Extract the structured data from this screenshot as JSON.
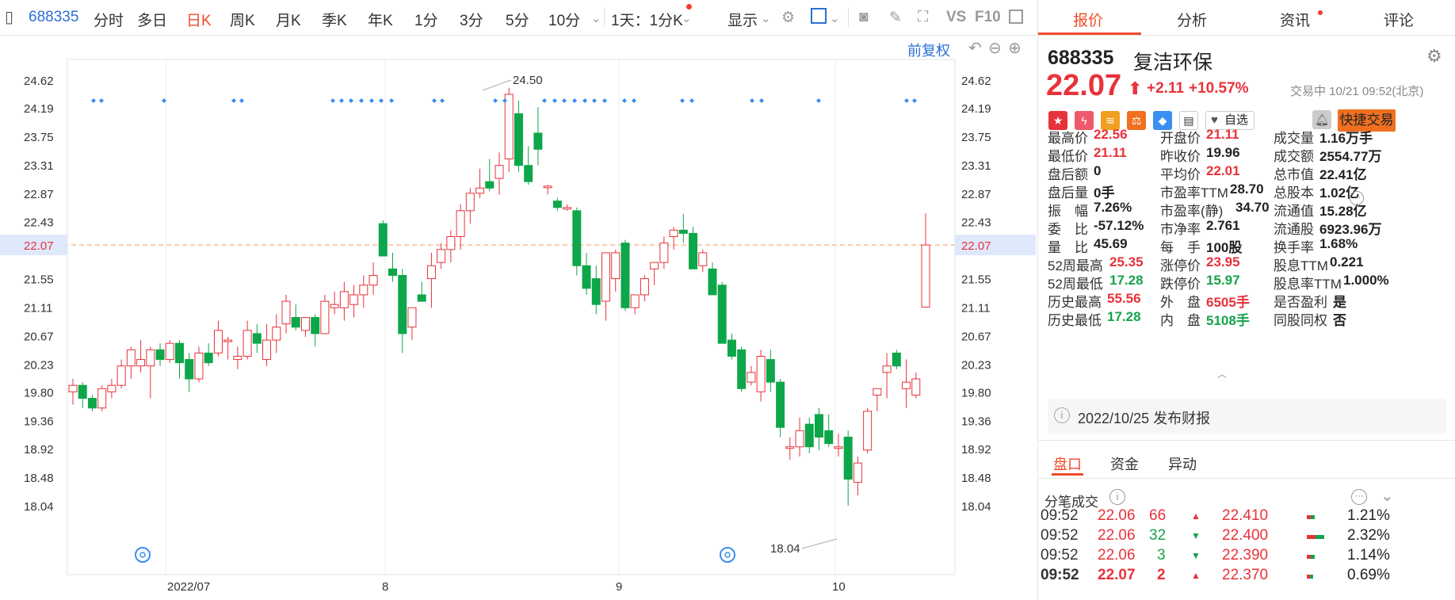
{
  "toolbar": {
    "stock_code": "688335",
    "tabs": [
      "分时",
      "多日",
      "日K",
      "周K",
      "月K",
      "季K",
      "年K",
      "1分",
      "3分",
      "5分",
      "10分"
    ],
    "active_tab": "日K",
    "period_select": "1天：1分K",
    "display_label": "显示",
    "vs_label": "VS",
    "f10_label": "F10",
    "adjust_label": "前复权"
  },
  "chart": {
    "y_ticks": [
      "24.62",
      "24.19",
      "23.75",
      "23.31",
      "22.87",
      "22.43",
      "22.07",
      "21.55",
      "21.11",
      "20.67",
      "20.23",
      "19.80",
      "19.36",
      "18.92",
      "18.48",
      "18.04"
    ],
    "current_price_label": "22.07",
    "x_labels": [
      "2022/07",
      "8",
      "9",
      "10"
    ],
    "high_annotation": "24.50",
    "low_annotation": "18.04"
  },
  "chart_data": {
    "type": "candlestick",
    "ylim": [
      17.8,
      24.8
    ],
    "current_price": 22.07,
    "xlabels": [
      "2022/07",
      "8",
      "9",
      "10"
    ],
    "ohlc": [
      [
        19.8,
        20.0,
        19.6,
        19.9
      ],
      [
        19.9,
        19.95,
        19.55,
        19.7
      ],
      [
        19.7,
        19.75,
        19.5,
        19.55
      ],
      [
        19.55,
        19.9,
        19.5,
        19.85
      ],
      [
        19.8,
        20.0,
        19.7,
        19.9
      ],
      [
        19.9,
        20.3,
        19.85,
        20.2
      ],
      [
        20.2,
        20.5,
        20.0,
        20.45
      ],
      [
        20.2,
        20.6,
        20.1,
        20.3
      ],
      [
        20.2,
        20.5,
        19.7,
        20.45
      ],
      [
        20.45,
        20.55,
        20.2,
        20.3
      ],
      [
        20.3,
        20.6,
        20.25,
        20.55
      ],
      [
        20.55,
        20.6,
        20.0,
        20.25
      ],
      [
        20.3,
        20.4,
        19.8,
        20.0
      ],
      [
        20.0,
        20.5,
        19.95,
        20.4
      ],
      [
        20.4,
        20.55,
        20.2,
        20.25
      ],
      [
        20.4,
        20.9,
        20.35,
        20.75
      ],
      [
        20.6,
        20.65,
        20.3,
        20.6
      ],
      [
        20.3,
        20.5,
        20.15,
        20.35
      ],
      [
        20.35,
        20.9,
        20.3,
        20.75
      ],
      [
        20.7,
        20.85,
        20.4,
        20.55
      ],
      [
        20.3,
        20.85,
        20.2,
        20.6
      ],
      [
        20.6,
        21.0,
        20.4,
        20.8
      ],
      [
        20.85,
        21.3,
        20.7,
        21.2
      ],
      [
        20.95,
        21.15,
        20.75,
        20.8
      ],
      [
        20.75,
        20.95,
        20.65,
        20.95
      ],
      [
        20.95,
        21.0,
        20.5,
        20.7
      ],
      [
        20.7,
        21.3,
        20.7,
        21.2
      ],
      [
        21.1,
        21.35,
        21.0,
        21.15
      ],
      [
        21.1,
        21.5,
        20.9,
        21.35
      ],
      [
        21.15,
        21.45,
        20.95,
        21.3
      ],
      [
        21.3,
        21.6,
        21.1,
        21.45
      ],
      [
        21.45,
        21.8,
        21.3,
        21.6
      ],
      [
        22.4,
        22.45,
        21.9,
        21.9
      ],
      [
        21.7,
        21.95,
        21.5,
        21.6
      ],
      [
        21.6,
        21.7,
        20.4,
        20.7
      ],
      [
        20.8,
        21.1,
        20.6,
        21.1
      ],
      [
        21.3,
        21.5,
        21.2,
        21.2
      ],
      [
        21.55,
        21.95,
        21.1,
        21.75
      ],
      [
        21.8,
        22.1,
        21.7,
        22.0
      ],
      [
        22.0,
        22.3,
        21.8,
        22.2
      ],
      [
        22.2,
        22.7,
        22.0,
        22.6
      ],
      [
        22.6,
        22.95,
        22.4,
        22.87
      ],
      [
        22.87,
        23.25,
        22.8,
        22.95
      ],
      [
        23.05,
        23.4,
        22.9,
        22.95
      ],
      [
        23.1,
        23.5,
        22.85,
        23.3
      ],
      [
        23.4,
        24.5,
        23.2,
        24.4
      ],
      [
        24.1,
        24.3,
        23.2,
        23.3
      ],
      [
        23.3,
        23.6,
        23.0,
        23.05
      ],
      [
        23.8,
        24.2,
        23.3,
        23.55
      ],
      [
        22.96,
        23.0,
        22.85,
        22.98
      ],
      [
        22.75,
        22.8,
        22.6,
        22.65
      ],
      [
        22.65,
        22.7,
        22.6,
        22.65
      ],
      [
        22.6,
        22.65,
        21.6,
        21.75
      ],
      [
        21.75,
        21.95,
        21.3,
        21.4
      ],
      [
        21.55,
        21.75,
        21.0,
        21.15
      ],
      [
        21.2,
        21.95,
        20.9,
        21.95
      ],
      [
        21.55,
        22.0,
        21.35,
        21.95
      ],
      [
        22.1,
        22.15,
        21.05,
        21.1
      ],
      [
        21.1,
        21.3,
        21.0,
        21.3
      ],
      [
        21.3,
        21.6,
        21.2,
        21.55
      ],
      [
        21.7,
        21.8,
        21.45,
        21.8
      ],
      [
        21.8,
        22.2,
        21.7,
        22.1
      ],
      [
        22.2,
        22.35,
        22.0,
        22.3
      ],
      [
        22.3,
        22.55,
        22.1,
        22.25
      ],
      [
        22.25,
        22.35,
        21.7,
        21.7
      ],
      [
        21.75,
        22.0,
        21.65,
        21.95
      ],
      [
        21.7,
        21.8,
        21.5,
        21.3
      ],
      [
        21.45,
        21.5,
        20.8,
        20.55
      ],
      [
        20.6,
        20.7,
        20.3,
        20.35
      ],
      [
        20.45,
        20.5,
        19.8,
        19.85
      ],
      [
        19.95,
        20.2,
        19.9,
        20.1
      ],
      [
        19.8,
        20.45,
        19.65,
        20.35
      ],
      [
        20.3,
        20.45,
        19.8,
        19.95
      ],
      [
        19.95,
        20.0,
        19.1,
        19.25
      ],
      [
        18.95,
        19.1,
        18.75,
        18.95
      ],
      [
        18.95,
        19.4,
        18.8,
        19.2
      ],
      [
        19.3,
        19.4,
        18.85,
        18.95
      ],
      [
        19.45,
        19.55,
        18.9,
        19.1
      ],
      [
        19.2,
        19.45,
        18.95,
        19.0
      ],
      [
        18.95,
        19.15,
        18.8,
        18.95
      ],
      [
        19.1,
        19.2,
        18.04,
        18.45
      ],
      [
        18.4,
        18.8,
        18.2,
        18.7
      ],
      [
        18.9,
        19.55,
        18.85,
        19.5
      ],
      [
        19.75,
        19.85,
        19.5,
        19.85
      ],
      [
        20.1,
        20.4,
        19.7,
        20.2
      ],
      [
        20.4,
        20.45,
        20.15,
        20.2
      ],
      [
        19.85,
        20.3,
        19.55,
        19.95
      ],
      [
        19.75,
        20.1,
        19.7,
        20.0
      ],
      [
        21.11,
        22.56,
        21.11,
        22.07
      ]
    ]
  },
  "quote": {
    "code": "688335",
    "name": "复洁环保",
    "price": "22.07",
    "change": "+2.11",
    "change_pct": "+10.57%",
    "status": "交易中 10/21 09:52(北京)",
    "watch_label": "自选",
    "trade_button": "快捷交易",
    "tabs": [
      "报价",
      "分析",
      "资讯",
      "评论"
    ],
    "stats_col1": [
      {
        "label": "最高价",
        "value": "22.56",
        "color": "red"
      },
      {
        "label": "最低价",
        "value": "21.11",
        "color": "red"
      },
      {
        "label": "盘后额",
        "value": "0",
        "color": "dark"
      },
      {
        "label": "盘后量",
        "value": "0手",
        "color": "dark"
      },
      {
        "label": "振　幅",
        "value": "7.26%",
        "color": "dark"
      },
      {
        "label": "委　比",
        "value": "-57.12%",
        "color": "dark"
      },
      {
        "label": "量　比",
        "value": "45.69",
        "color": "dark"
      },
      {
        "label": "52周最高",
        "value": "25.35",
        "color": "red"
      },
      {
        "label": "52周最低",
        "value": "17.28",
        "color": "green"
      },
      {
        "label": "历史最高",
        "value": "55.56",
        "color": "red"
      },
      {
        "label": "历史最低",
        "value": "17.28",
        "color": "green"
      }
    ],
    "stats_col2": [
      {
        "label": "开盘价",
        "value": "21.11",
        "color": "red"
      },
      {
        "label": "昨收价",
        "value": "19.96",
        "color": "dark"
      },
      {
        "label": "平均价",
        "value": "22.01",
        "color": "red"
      },
      {
        "label": "市盈率TTM",
        "value": "28.70",
        "color": "dark"
      },
      {
        "label": "市盈率(静)",
        "value": "34.70",
        "color": "dark"
      },
      {
        "label": "市净率",
        "value": "2.761",
        "color": "dark"
      },
      {
        "label": "每　手",
        "value": "100股",
        "color": "dark"
      },
      {
        "label": "涨停价",
        "value": "23.95",
        "color": "red"
      },
      {
        "label": "跌停价",
        "value": "15.97",
        "color": "green"
      },
      {
        "label": "外　盘",
        "value": "6505手",
        "color": "red"
      },
      {
        "label": "内　盘",
        "value": "5108手",
        "color": "green"
      }
    ],
    "stats_col3": [
      {
        "label": "成交量",
        "value": "1.16万手",
        "color": "dark"
      },
      {
        "label": "成交额",
        "value": "2554.77万",
        "color": "dark"
      },
      {
        "label": "总市值",
        "value": "22.41亿",
        "color": "dark"
      },
      {
        "label": "总股本",
        "value": "1.02亿",
        "color": "dark"
      },
      {
        "label": "流通值",
        "value": "15.28亿",
        "color": "dark"
      },
      {
        "label": "流通股",
        "value": "6923.96万",
        "color": "dark"
      },
      {
        "label": "换手率",
        "value": "1.68%",
        "color": "dark"
      },
      {
        "label": "股息TTM",
        "value": "0.221",
        "color": "dark"
      },
      {
        "label": "股息率TTM",
        "value": "1.000%",
        "color": "dark"
      },
      {
        "label": "是否盈利",
        "value": "是",
        "color": "dark"
      },
      {
        "label": "同股同权",
        "value": "否",
        "color": "dark"
      }
    ],
    "notice": "2022/10/25  发布财报",
    "sub_tabs": [
      "盘口",
      "资金",
      "异动"
    ],
    "trades_title": "分笔成交",
    "trades": [
      {
        "time": "09:52",
        "price": "22.06",
        "vol": "66",
        "dir": "up"
      },
      {
        "time": "09:52",
        "price": "22.06",
        "vol": "32",
        "dir": "down"
      },
      {
        "time": "09:52",
        "price": "22.06",
        "vol": "3",
        "dir": "down"
      },
      {
        "time": "09:52",
        "price": "22.07",
        "vol": "2",
        "dir": "up"
      }
    ],
    "levels": [
      {
        "price": "22.410",
        "pct": "1.21%"
      },
      {
        "price": "22.400",
        "pct": "2.32%"
      },
      {
        "price": "22.390",
        "pct": "1.14%"
      },
      {
        "price": "22.370",
        "pct": "0.69%"
      }
    ]
  },
  "colors": {
    "up": "#e8323a",
    "down": "#0ea64a",
    "accent": "#f04a2a",
    "link": "#2b6fd6"
  }
}
